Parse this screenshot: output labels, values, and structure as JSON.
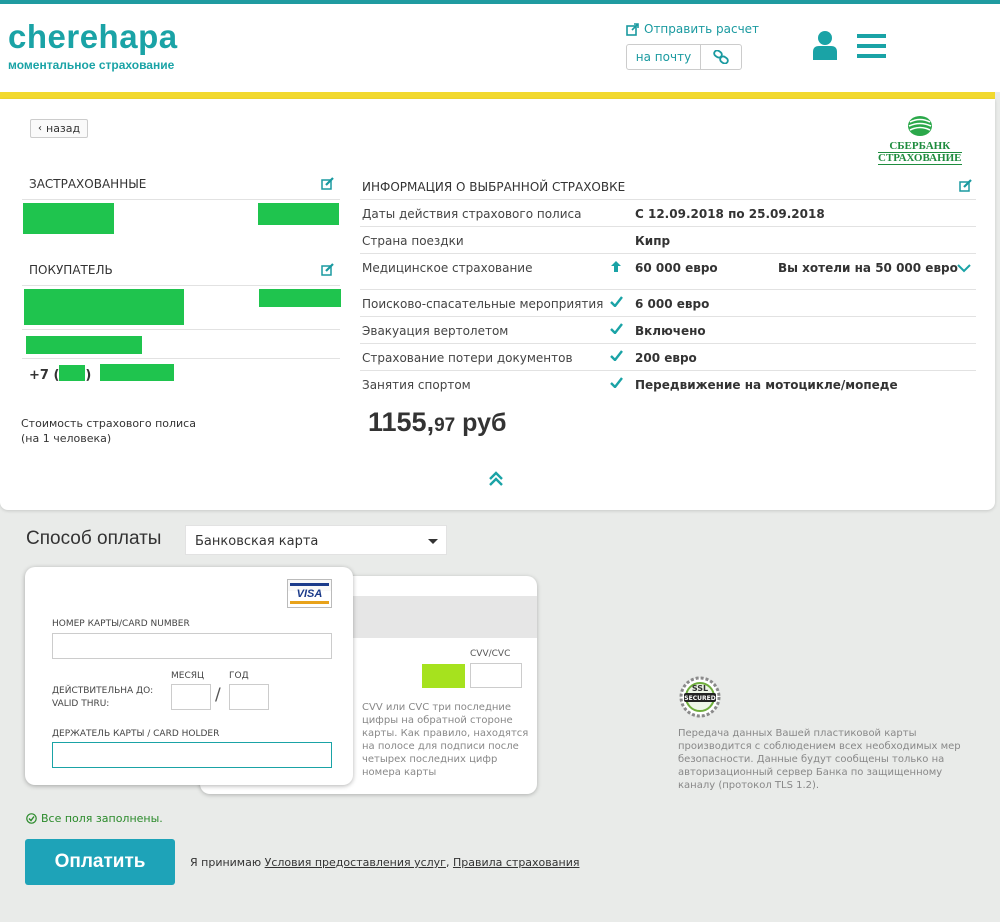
{
  "header": {
    "logo": "cherehapa",
    "tagline": "моментальное страхование",
    "send_title": "Отправить расчет",
    "send_email_label": "на почту"
  },
  "panel": {
    "back_label": "назад",
    "insurer_logo_text": [
      "СБЕРБАНК",
      "СТРАХОВАНИЕ"
    ],
    "insured_title": "ЗАСТРАХОВАННЫЕ",
    "buyer_title": "ПОКУПАТЕЛЬ",
    "phone_prefix": "+7 (",
    "phone_mid": ")",
    "cost_label_line1": "Стоимость страхового полиса",
    "cost_label_line2": "(на 1 человека)",
    "price_main": "1155,",
    "price_kop": "97",
    "price_currency": " руб",
    "info_title": "ИНФОРМАЦИЯ О ВЫБРАННОЙ СТРАХОВКЕ",
    "rows": [
      {
        "label": "Даты действия страхового полиса",
        "value": "С 12.09.2018 по 25.09.2018",
        "icon": ""
      },
      {
        "label": "Страна поездки",
        "value": "Кипр",
        "icon": ""
      },
      {
        "label": "Медицинское страхование",
        "value": "60 000 евро",
        "icon": "arrow-up-icon",
        "extra": "Вы хотели на 50 000 евро"
      },
      {
        "label": "Поисково-спасательные мероприятия",
        "value": "6 000 евро",
        "icon": "check-icon"
      },
      {
        "label": "Эвакуация вертолетом",
        "value": "Включено",
        "icon": "check-icon"
      },
      {
        "label": "Страхование потери документов",
        "value": "200 евро",
        "icon": "check-icon"
      },
      {
        "label": "Занятия спортом",
        "value": "Передвижение на мотоцикле/мопеде",
        "icon": "check-icon"
      }
    ]
  },
  "payment": {
    "title": "Способ оплаты",
    "method_selected": "Банковская карта",
    "card_brand": "VISA",
    "card_number_label": "НОМЕР КАРТЫ/CARD NUMBER",
    "month_label": "МЕСЯЦ",
    "year_label": "ГОД",
    "valid_label_1": "ДЕЙСТВИТЕЛЬНА ДО:",
    "valid_label_2": "VALID THRU:",
    "slash": "/",
    "holder_label": "ДЕРЖАТЕЛЬ КАРТЫ / CARD HOLDER",
    "cvv_label": "CVV/CVC",
    "cvv_help": "CVV или CVC три последние цифры на обратной стороне карты. Как правило, находятся на полосе для подписи после четырех последних цифр номера карты",
    "ssl_badge_text": [
      "SSL",
      "SECURED"
    ],
    "ssl_text": "Передача данных Вашей пластиковой карты производится с соблюдением всех необходимых мер безопасности. Данные будут сообщены только на авторизационный сервер Банка по защищенному каналу (протокол TLS 1.2).",
    "status_ok": "Все поля заполнены.",
    "pay_button": "Оплатить",
    "terms_prefix": "Я принимаю ",
    "terms_link1": "Условия предоставления услуг",
    "terms_sep": ", ",
    "terms_link2": "Правила страхования"
  },
  "colors": {
    "accent": "#1aa3a6",
    "button": "#1ea3b8",
    "redaction": "#1fc44e",
    "yellow": "#f2d92e"
  }
}
